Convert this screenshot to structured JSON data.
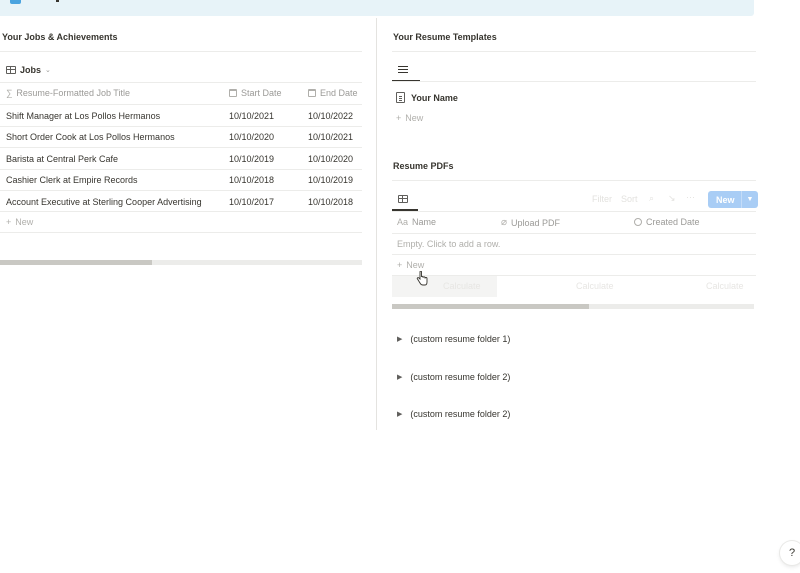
{
  "left": {
    "heading": "Your Jobs & Achievements",
    "view_tab": "Jobs",
    "columns": [
      "Resume-Formatted Job Title",
      "Start Date",
      "End Date"
    ],
    "rows": [
      [
        "Shift Manager at Los Pollos Hermanos",
        "10/10/2021",
        "10/10/2022"
      ],
      [
        "Short Order Cook at Los Pollos Hermanos",
        "10/10/2020",
        "10/10/2021"
      ],
      [
        "Barista at Central Perk Cafe",
        "10/10/2019",
        "10/10/2020"
      ],
      [
        "Cashier Clerk at Empire Records",
        "10/10/2018",
        "10/10/2019"
      ],
      [
        "Account Executive at Sterling Cooper Advertising",
        "10/10/2017",
        "10/10/2018"
      ]
    ],
    "new_label": "New"
  },
  "templates": {
    "heading": "Your Resume Templates",
    "item": "Your Name",
    "new_label": "New"
  },
  "pdfs": {
    "heading": "Resume PDFs",
    "toolbar": [
      "Filter",
      "Sort"
    ],
    "new_button": "New",
    "columns": [
      "Name",
      "Upload PDF",
      "Created Date"
    ],
    "column_prefix": "Aa",
    "empty_text": "Empty. Click to add a row.",
    "new_label": "New",
    "ghost_labels": [
      "Calculate",
      "Calculate",
      "Calculate"
    ]
  },
  "toggles": [
    "(custom resume folder 1)",
    "(custom resume folder 2)",
    "(custom resume folder 2)"
  ],
  "help": "?",
  "colors": {
    "banner": "#e7f3f8",
    "new_button": "#a9cdf5",
    "text": "#37352f",
    "muted": "#9b9a97"
  }
}
